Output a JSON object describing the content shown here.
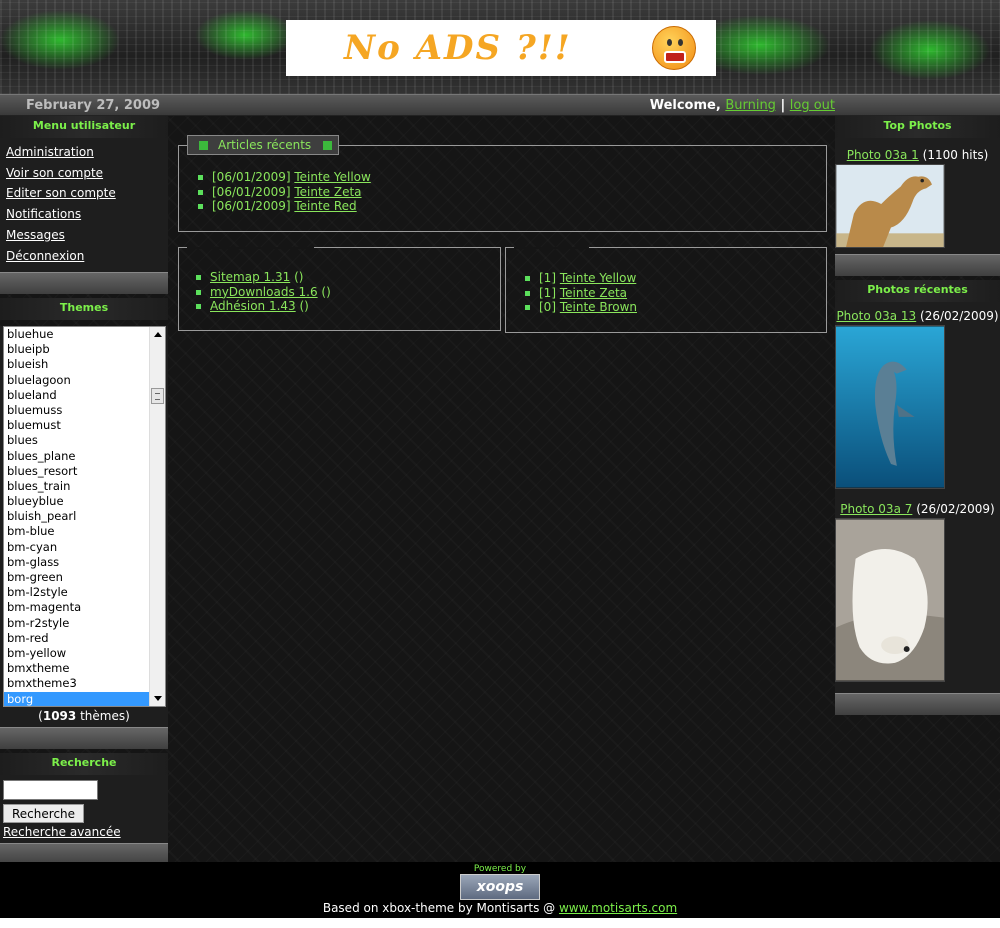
{
  "header": {
    "banner_text": "No ADS ?!!"
  },
  "topbar": {
    "date": "February 27, 2009",
    "welcome_label": "Welcome,",
    "username": "Burning",
    "separator": "|",
    "logout": "log out"
  },
  "usermenu": {
    "title": "Menu utilisateur",
    "items": [
      "Administration",
      "Voir son compte",
      "Editer son compte",
      "Notifications",
      "Messages",
      "Déconnexion"
    ]
  },
  "themes": {
    "title": "Themes",
    "items": [
      "bluehue",
      "blueipb",
      "blueish",
      "bluelagoon",
      "blueland",
      "bluemuss",
      "bluemust",
      "blues",
      "blues_plane",
      "blues_resort",
      "blues_train",
      "blueyblue",
      "bluish_pearl",
      "bm-blue",
      "bm-cyan",
      "bm-glass",
      "bm-green",
      "bm-l2style",
      "bm-magenta",
      "bm-r2style",
      "bm-red",
      "bm-yellow",
      "bmxtheme",
      "bmxtheme3",
      "borg"
    ],
    "selected": "borg",
    "count": "1093",
    "count_suffix": "thèmes"
  },
  "search": {
    "title": "Recherche",
    "button": "Recherche",
    "advanced": "Recherche avancée",
    "value": ""
  },
  "articles": {
    "title": "Articles récents",
    "items": [
      {
        "date": "[06/01/2009]",
        "link": "Teinte Yellow"
      },
      {
        "date": "[06/01/2009]",
        "link": "Teinte Zeta"
      },
      {
        "date": "[06/01/2009]",
        "link": "Teinte Red"
      }
    ]
  },
  "downloads": {
    "items": [
      {
        "link": "Sitemap 1.31",
        "suffix": "()"
      },
      {
        "link": "myDownloads 1.6",
        "suffix": "()"
      },
      {
        "link": "Adhésion 1.43",
        "suffix": "()"
      }
    ]
  },
  "ranked": {
    "items": [
      {
        "count": "[1]",
        "link": "Teinte Yellow"
      },
      {
        "count": "[1]",
        "link": "Teinte Zeta"
      },
      {
        "count": "[0]",
        "link": "Teinte Brown"
      }
    ]
  },
  "top_photos": {
    "title": "Top Photos",
    "items": [
      {
        "link": "Photo 03a 1",
        "meta": "(1100 hits)",
        "subject": "camel"
      }
    ]
  },
  "recent_photos": {
    "title": "Photos récentes",
    "items": [
      {
        "link": "Photo 03a 13",
        "meta": "(26/02/2009)",
        "subject": "dolphin"
      },
      {
        "link": "Photo 03a 7",
        "meta": "(26/02/2009)",
        "subject": "polar-bear"
      }
    ]
  },
  "footer": {
    "powered": "Powered by",
    "badge": "xoops",
    "based_on": "Based on xbox-theme by Montisarts @",
    "site": "www.motisarts.com"
  }
}
